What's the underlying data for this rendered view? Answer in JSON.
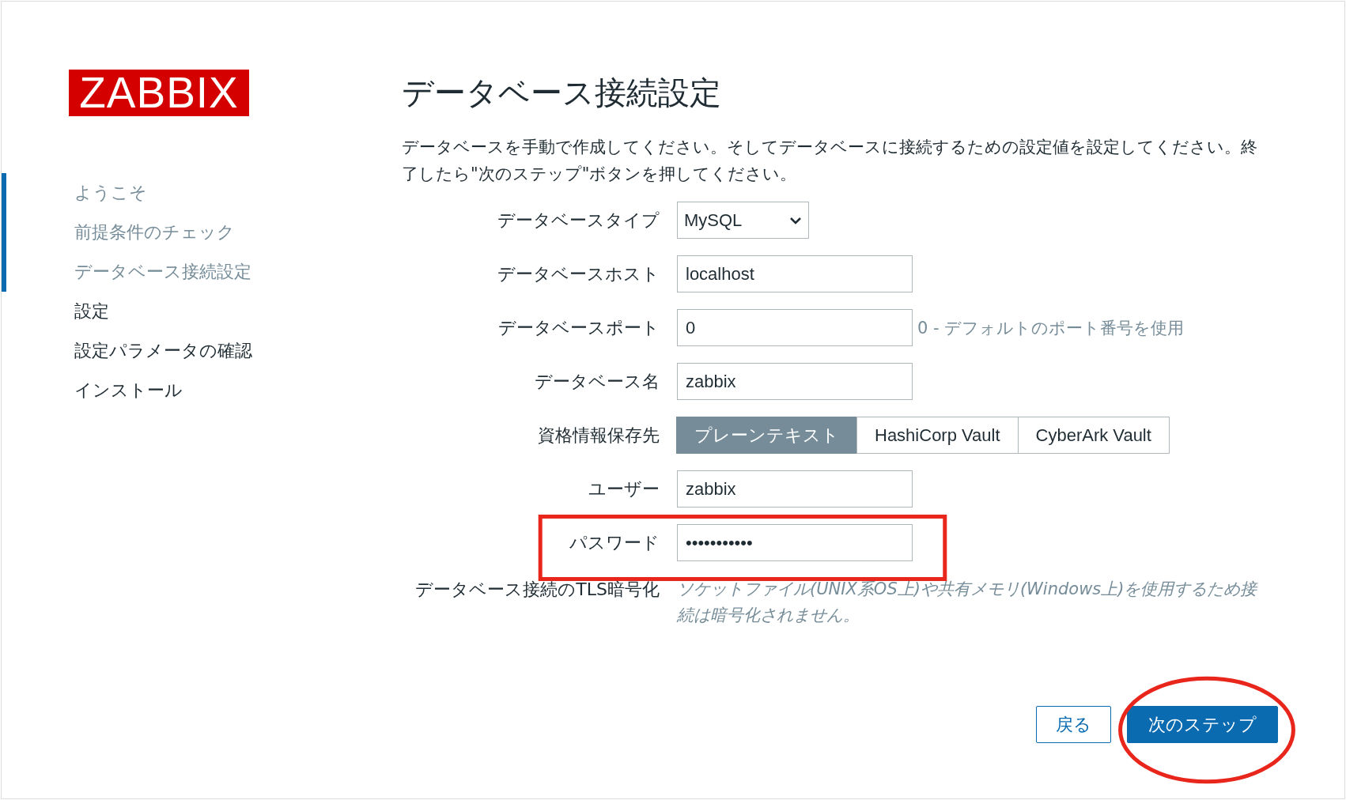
{
  "logo": "ZABBIX",
  "steps": [
    {
      "label": "ようこそ",
      "completed": true
    },
    {
      "label": "前提条件のチェック",
      "completed": true
    },
    {
      "label": "データベース接続設定",
      "completed": true
    },
    {
      "label": "設定",
      "completed": false
    },
    {
      "label": "設定パラメータの確認",
      "completed": false
    },
    {
      "label": "インストール",
      "completed": false
    }
  ],
  "title": "データベース接続設定",
  "description": "データベースを手動で作成してください。そしてデータベースに接続するための設定値を設定してください。終了したら\"次のステップ\"ボタンを押してください。",
  "form": [
    {
      "kind": "select",
      "label": "データベースタイプ",
      "value": "MySQL"
    },
    {
      "kind": "input",
      "label": "データベースホスト",
      "value": "localhost"
    },
    {
      "kind": "input",
      "label": "データベースポート",
      "value": "0",
      "hint": "0 - デフォルトのポート番号を使用"
    },
    {
      "kind": "input",
      "label": "データベース名",
      "value": "zabbix"
    },
    {
      "kind": "segmented",
      "label": "資格情報保存先",
      "options": [
        {
          "label": "プレーンテキスト",
          "selected": true
        },
        {
          "label": "HashiCorp Vault",
          "selected": false
        },
        {
          "label": "CyberArk Vault",
          "selected": false
        }
      ]
    },
    {
      "kind": "input",
      "label": "ユーザー",
      "value": "zabbix"
    },
    {
      "kind": "password",
      "label": "パスワード",
      "value": "•••••••••••"
    },
    {
      "kind": "note",
      "label": "データベース接続のTLS暗号化",
      "text": "ソケットファイル(UNIX系OS上)や共有メモリ(Windows上)を使用するため接続は暗号化されません。"
    }
  ],
  "buttons": [
    {
      "label": "戻る",
      "kind": "secondary"
    },
    {
      "label": "次のステップ",
      "kind": "primary"
    }
  ],
  "annotations": [
    {
      "kind": "rectangle",
      "color": "#e8261c"
    },
    {
      "kind": "ellipse",
      "color": "#e8261c"
    }
  ]
}
